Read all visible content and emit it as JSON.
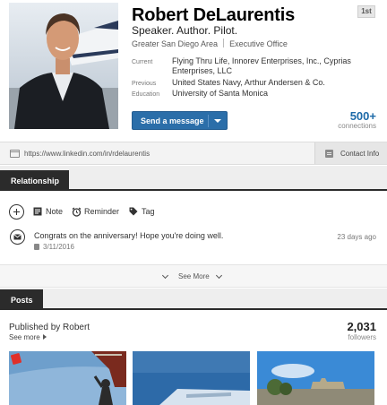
{
  "profile": {
    "name": "Robert DeLaurentis",
    "degree": "1st",
    "headline": "Speaker. Author. Pilot.",
    "location": "Greater San Diego Area",
    "industry": "Executive Office",
    "current_label": "Current",
    "current_value": "Flying Thru Life, Innorev Enterprises, Inc., Cyprias Enterprises, LLC",
    "previous_label": "Previous",
    "previous_value": "United States Navy, Arthur Andersen & Co.",
    "education_label": "Education",
    "education_value": "University of Santa Monica",
    "send_message_label": "Send a message",
    "connections_count": "500+",
    "connections_label": "connections"
  },
  "url_bar": {
    "url": "https://www.linkedin.com/in/rdelaurentis",
    "contact_info_label": "Contact Info"
  },
  "relationship": {
    "tab_label": "Relationship",
    "note_label": "Note",
    "reminder_label": "Reminder",
    "tag_label": "Tag",
    "activity_text": "Congrats on the anniversary! Hope you're doing well.",
    "activity_date": "3/11/2016",
    "activity_time": "23 days ago",
    "see_more_label": "See More"
  },
  "posts": {
    "tab_label": "Posts",
    "published_by": "Published by Robert",
    "see_more_label": "See more",
    "followers_count": "2,031",
    "followers_label": "followers"
  },
  "colors": {
    "accent_blue": "#2b6ea9",
    "link_blue": "#1d6aa8",
    "tab_dark": "#2b2b2b"
  },
  "icons": [
    "external-link-icon",
    "contact-card-icon",
    "add-icon",
    "note-icon",
    "alarm-clock-icon",
    "tag-icon",
    "message-icon",
    "calendar-icon",
    "chevron-down-icon",
    "caret-down-icon",
    "caret-right-icon"
  ]
}
